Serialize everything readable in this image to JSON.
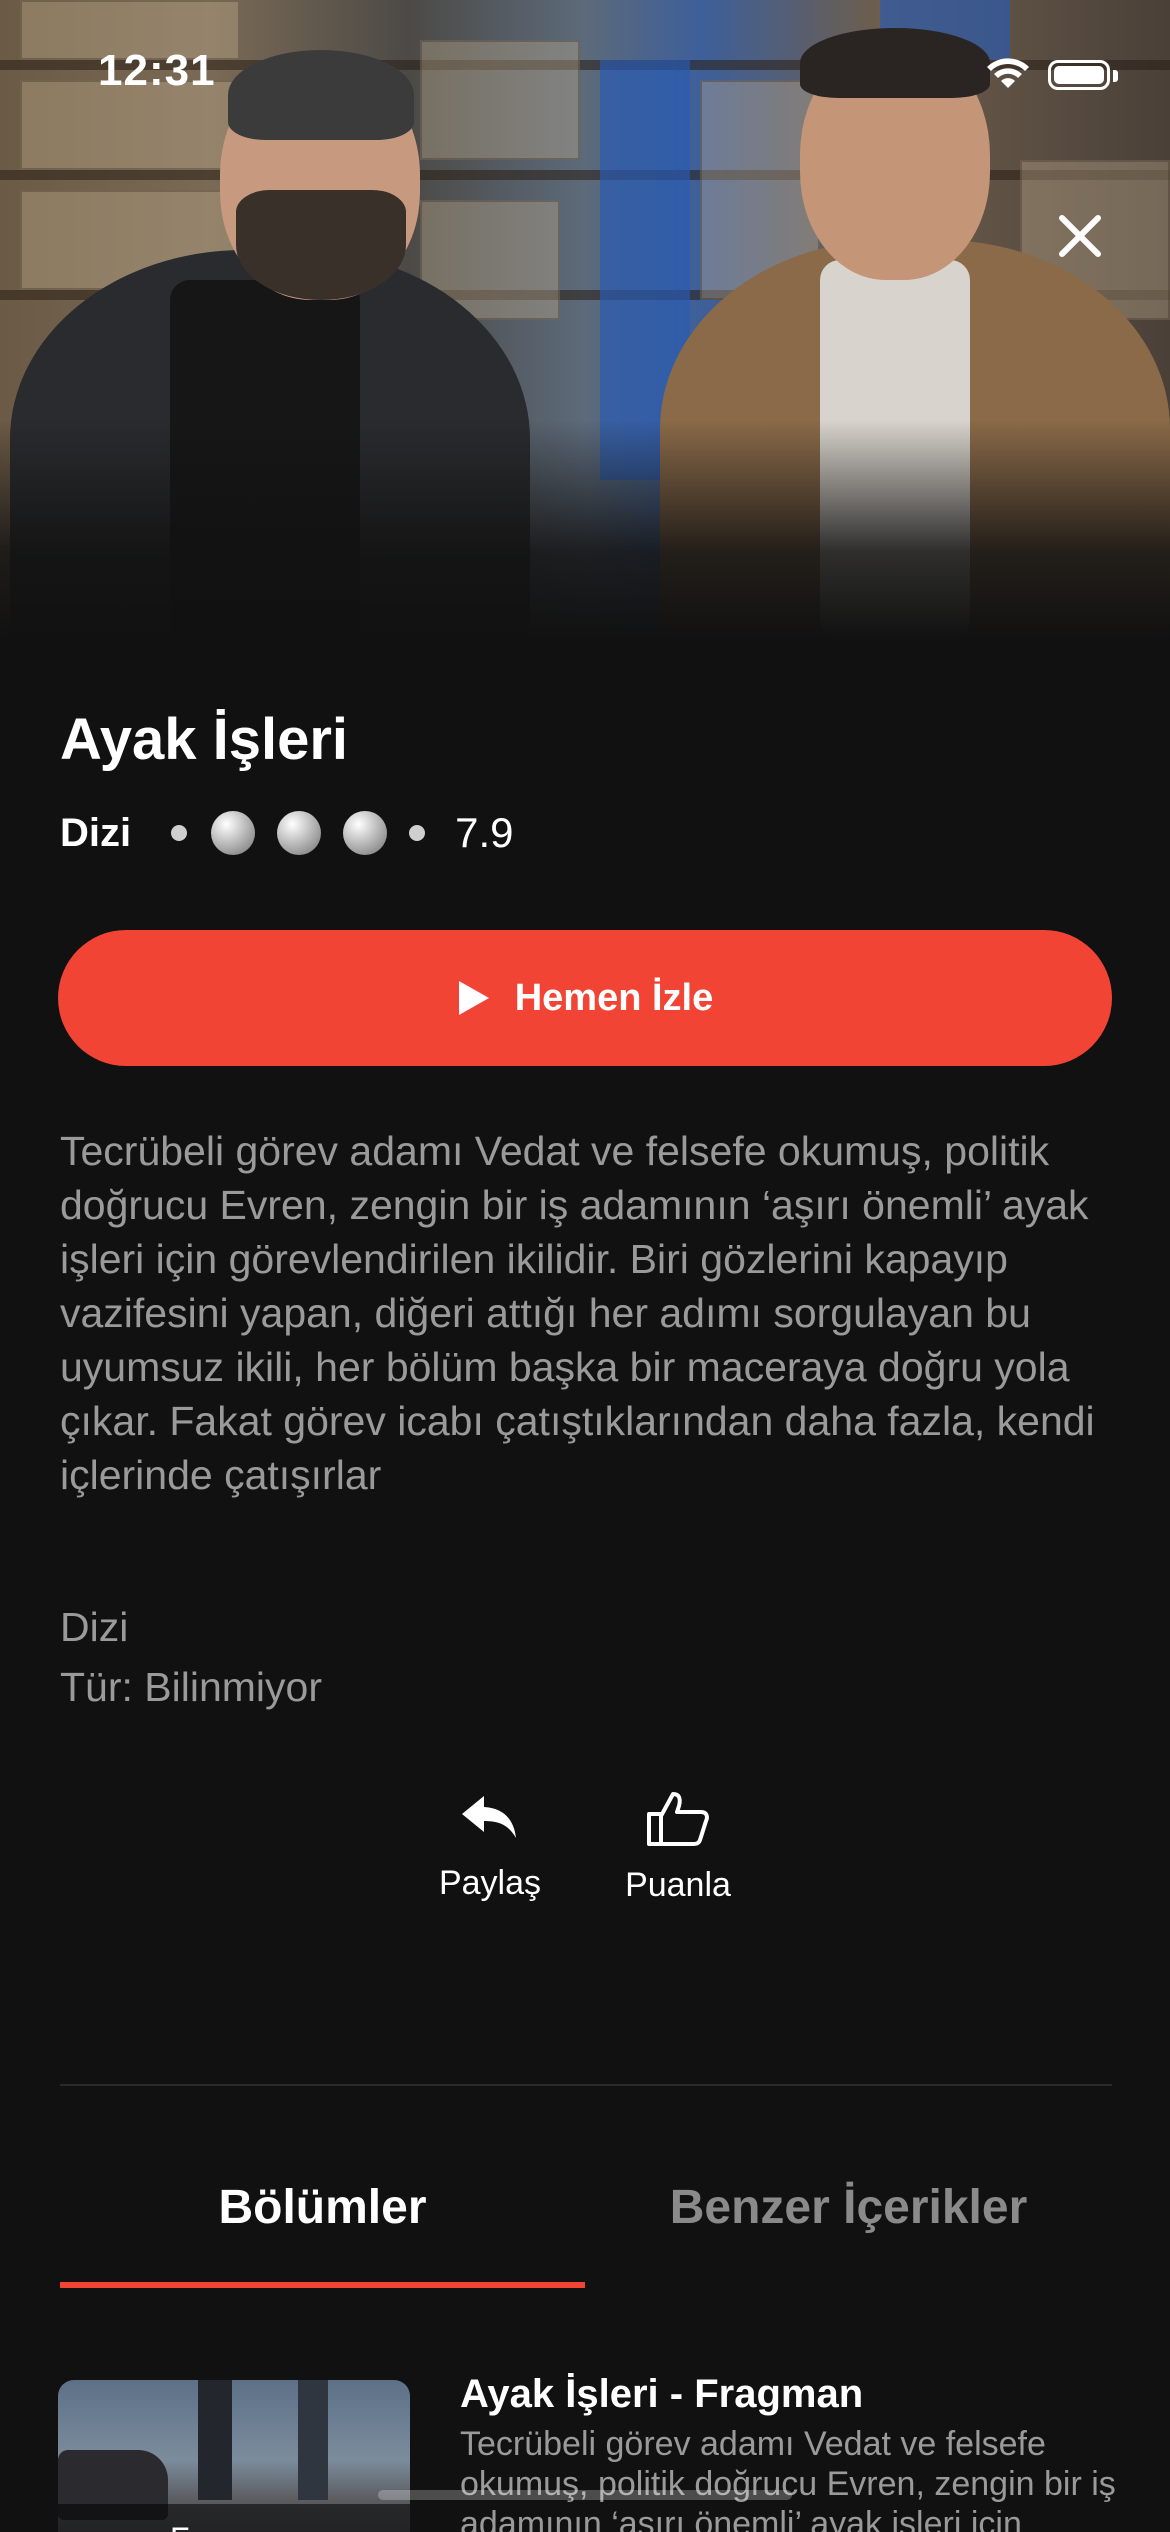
{
  "status_bar": {
    "time": "12:31"
  },
  "content": {
    "title": "Ayak İşleri",
    "type_label": "Dizi",
    "score": "7.9",
    "watch_button": "Hemen İzle",
    "description": "Tecrübeli görev adamı Vedat ve felsefe okumuş, politik doğrucu Evren, zengin bir iş adamının ‘aşırı önemli’ ayak işleri için görevlendirilen ikilidir. Biri gözlerini kapayıp vazifesini yapan, diğeri attığı her adımı sorgulayan bu uyumsuz ikili, her bölüm başka bir maceraya doğru yola çıkar. Fakat görev icabı çatıştıklarından daha fazla, kendi içlerinde çatışırlar",
    "info_type": "Dizi",
    "info_genre": "Tür: Bilinmiyor"
  },
  "actions": {
    "share_label": "Paylaş",
    "rate_label": "Puanla"
  },
  "tabs": [
    {
      "label": "Bölümler",
      "active": true
    },
    {
      "label": "Benzer İçerikler",
      "active": false
    }
  ],
  "episodes": [
    {
      "title": "Ayak İşleri - Fragman",
      "thumbnail_label": "Fragman",
      "description": "Tecrübeli görev adamı Vedat ve felsefe okumuş, politik doğrucu Evren, zengin bir iş adamının ‘aşırı önemli’ ayak işleri için"
    }
  ],
  "icons": {
    "close": "close-icon",
    "play": "play-icon",
    "share": "reply-icon",
    "rate": "thumbs-up-icon"
  },
  "colors": {
    "accent": "#f14435",
    "background": "#111111",
    "muted_text": "#9a9a9a"
  }
}
